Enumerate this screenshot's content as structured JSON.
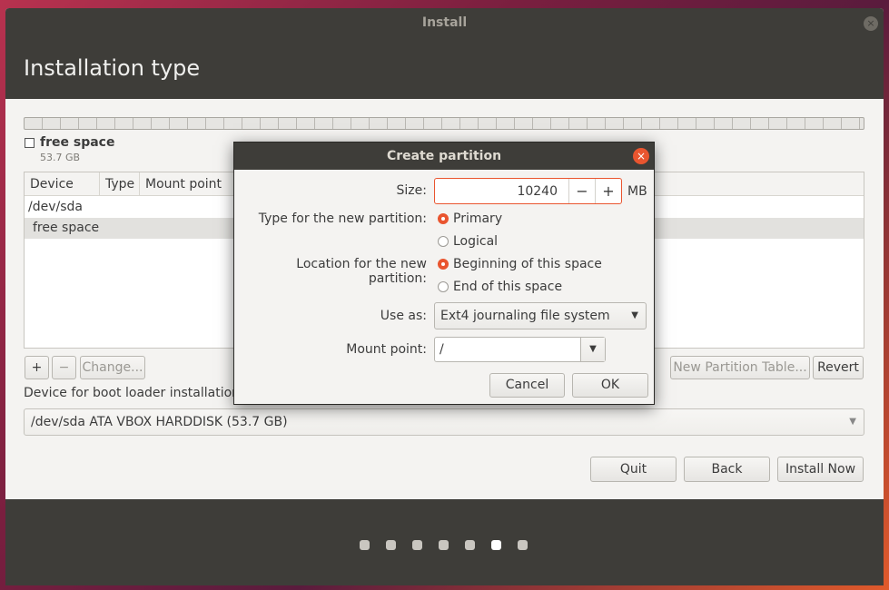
{
  "window": {
    "title": "Install",
    "close_glyph": "×"
  },
  "page": {
    "title": "Installation type"
  },
  "legend": {
    "name": "free space",
    "size": "53.7 GB"
  },
  "table": {
    "columns": [
      "Device",
      "Type",
      "Mount point"
    ],
    "rows": [
      {
        "device": "/dev/sda"
      },
      {
        "device": "free space"
      }
    ]
  },
  "toolbar": {
    "add": "+",
    "remove": "−",
    "change": "Change...",
    "new_table": "New Partition Table...",
    "revert": "Revert"
  },
  "bootloader": {
    "label": "Device for boot loader installation:",
    "value": "/dev/sda ATA VBOX HARDDISK (53.7 GB)"
  },
  "nav": {
    "quit": "Quit",
    "back": "Back",
    "install_now": "Install Now"
  },
  "progress": {
    "total_steps": 7,
    "current_step": 6
  },
  "dialog": {
    "title": "Create partition",
    "size_label": "Size:",
    "size_value": "10240",
    "size_unit": "MB",
    "decrement": "−",
    "increment": "+",
    "type_label": "Type for the new partition:",
    "type_options": [
      "Primary",
      "Logical"
    ],
    "type_selected": "Primary",
    "location_label": "Location for the new partition:",
    "location_options": [
      "Beginning of this space",
      "End of this space"
    ],
    "location_selected": "Beginning of this space",
    "useas_label": "Use as:",
    "useas_value": "Ext4 journaling file system",
    "mount_label": "Mount point:",
    "mount_value": "/",
    "cancel": "Cancel",
    "ok": "OK"
  },
  "colors": {
    "accent": "#e9552f",
    "header": "#3e3d39",
    "surface": "#f4f3f1"
  },
  "icons": {
    "close": "close-icon",
    "dropdown": "chevron-down-icon"
  }
}
